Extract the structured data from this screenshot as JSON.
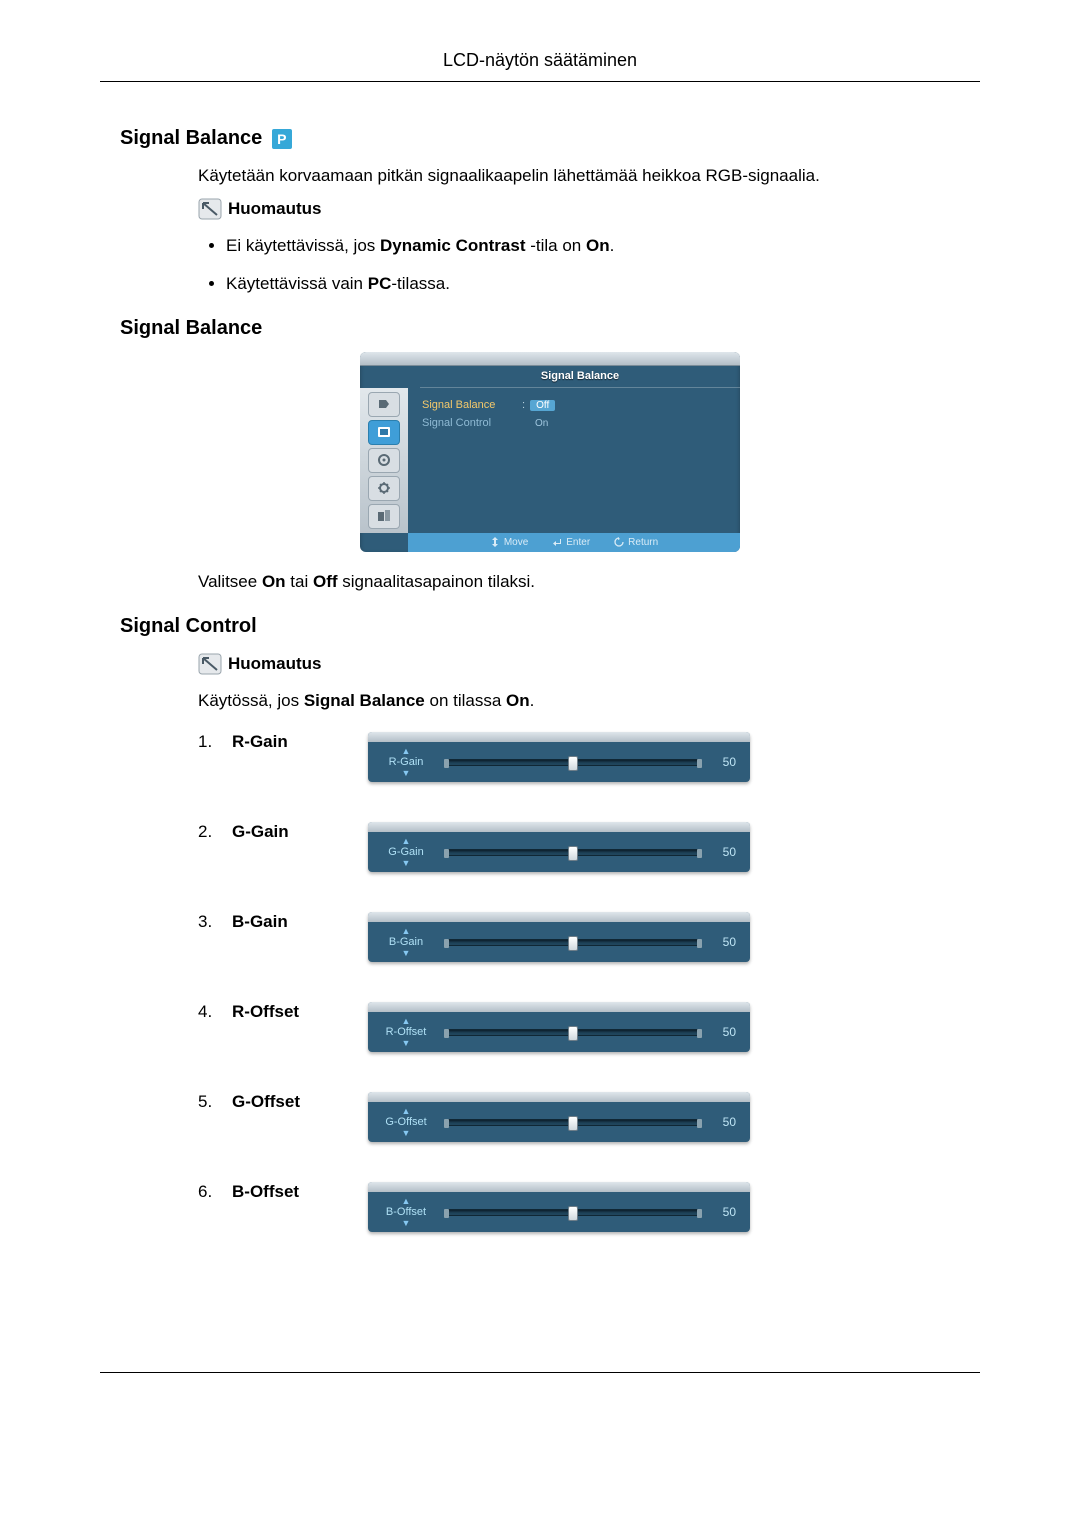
{
  "page_title": "LCD-näytön säätäminen",
  "sections": {
    "sig_bal_1": {
      "heading": "Signal Balance"
    },
    "sig_bal_2": {
      "heading": "Signal Balance"
    },
    "sig_ctrl": {
      "heading": "Signal Control"
    }
  },
  "intro_text": "Käytetään korvaamaan pitkän signaalikaapelin lähettämää heikkoa RGB-signaalia.",
  "note_label": "Huomautus",
  "bullets_1": {
    "b1_pre": "Ei käytettävissä, jos ",
    "b1_bold": "Dynamic Contrast",
    "b1_mid": " -tila on ",
    "b1_bold2": "On",
    "b1_end": ".",
    "b2_pre": "Käytettävissä vain ",
    "b2_bold": "PC",
    "b2_end": "-tilassa."
  },
  "osd": {
    "title": "Signal Balance",
    "rows": {
      "r1": "Signal Balance",
      "r2": "Signal Control"
    },
    "options": {
      "off": "Off",
      "on": "On"
    },
    "hints": {
      "move": "Move",
      "enter": "Enter",
      "return": "Return"
    }
  },
  "after_osd": {
    "pre": "Valitsee ",
    "b1": "On",
    "mid": " tai ",
    "b2": "Off",
    "end": " signaalitasapainon tilaksi."
  },
  "sig_ctrl_text": {
    "pre": "Käytössä, jos ",
    "b1": "Signal Balance",
    "mid": " on tilassa ",
    "b2": "On",
    "end": "."
  },
  "sliders": [
    {
      "num": "1.",
      "label": "R-Gain",
      "osd_label": "R-Gain",
      "value": "50"
    },
    {
      "num": "2.",
      "label": "G-Gain",
      "osd_label": "G-Gain",
      "value": "50"
    },
    {
      "num": "3.",
      "label": "B-Gain",
      "osd_label": "B-Gain",
      "value": "50"
    },
    {
      "num": "4.",
      "label": "R-Offset",
      "osd_label": "R-Offset",
      "value": "50"
    },
    {
      "num": "5.",
      "label": "G-Offset",
      "osd_label": "G-Offset",
      "value": "50"
    },
    {
      "num": "6.",
      "label": "B-Offset",
      "osd_label": "B-Offset",
      "value": "50"
    }
  ],
  "icons": {
    "p_badge": "P"
  }
}
